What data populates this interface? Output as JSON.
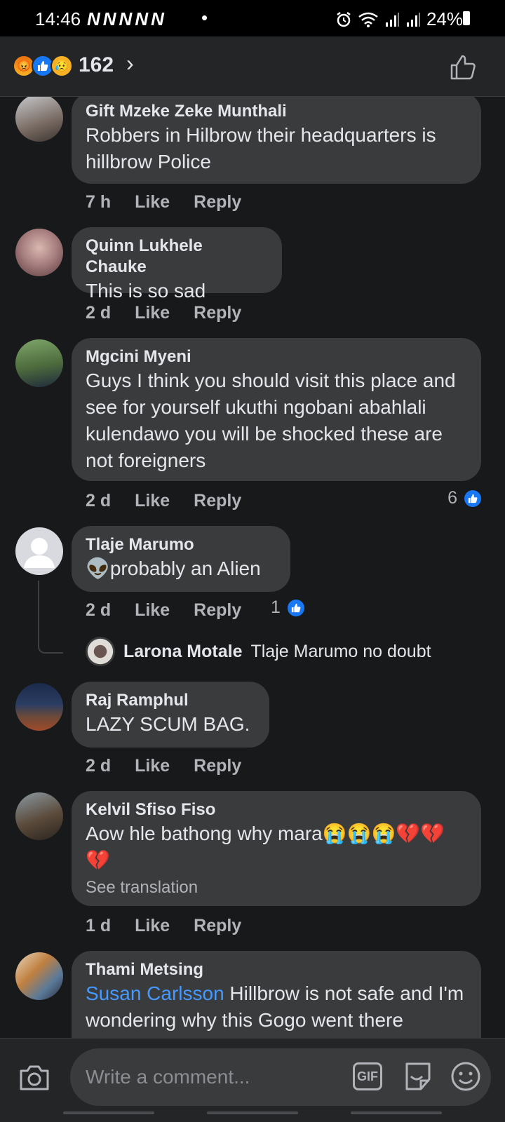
{
  "status_bar": {
    "time": "14:46",
    "notifications": "NNNNN",
    "dot": "•",
    "alarm_icon": "alarm-icon",
    "wifi_icon": "wifi-icon",
    "battery": "24%"
  },
  "reactions": {
    "count": "162",
    "types": [
      "angry",
      "like",
      "sad"
    ]
  },
  "comments": [
    {
      "author": "Gift Mzeke Zeke Munthali",
      "text": "Robbers in Hilbrow their headquarters is hillbrow Police",
      "time": "7 h",
      "like": "Like",
      "reply": "Reply"
    },
    {
      "author": "Quinn Lukhele Chauke",
      "text": "This is so sad",
      "time": "2 d",
      "like": "Like",
      "reply": "Reply"
    },
    {
      "author": "Mgcini Myeni",
      "text": "Guys I think you should visit this place and see for yourself ukuthi ngobani abahlali kulendawo you will be shocked these are not foreigners",
      "time": "2 d",
      "like": "Like",
      "reply": "Reply",
      "likes": "6"
    },
    {
      "author": "Tlaje Marumo",
      "text": "👽probably an Alien",
      "time": "2 d",
      "like": "Like",
      "reply": "Reply",
      "likes": "1",
      "reply_preview": {
        "author": "Larona Motale",
        "text": "Tlaje Marumo no doubt"
      }
    },
    {
      "author": "Raj Ramphul",
      "text": "LAZY SCUM BAG.",
      "time": "2 d",
      "like": "Like",
      "reply": "Reply"
    },
    {
      "author": "Kelvil Sfiso Fiso",
      "text": "Aow hle bathong why mara😭😭😭💔💔💔",
      "see_translation": "See translation",
      "time": "1 d",
      "like": "Like",
      "reply": "Reply"
    },
    {
      "author": "Thami Metsing",
      "mention": "Susan Carlsson",
      "text": " Hillbrow is not safe and I'm wondering why this Gogo went there"
    }
  ],
  "composer": {
    "placeholder": "Write a comment...",
    "gif_label": "GIF"
  },
  "colors": {
    "background": "#18191a",
    "bubble": "#3a3b3c",
    "accent": "#1877f2",
    "mention": "#4599ff"
  }
}
